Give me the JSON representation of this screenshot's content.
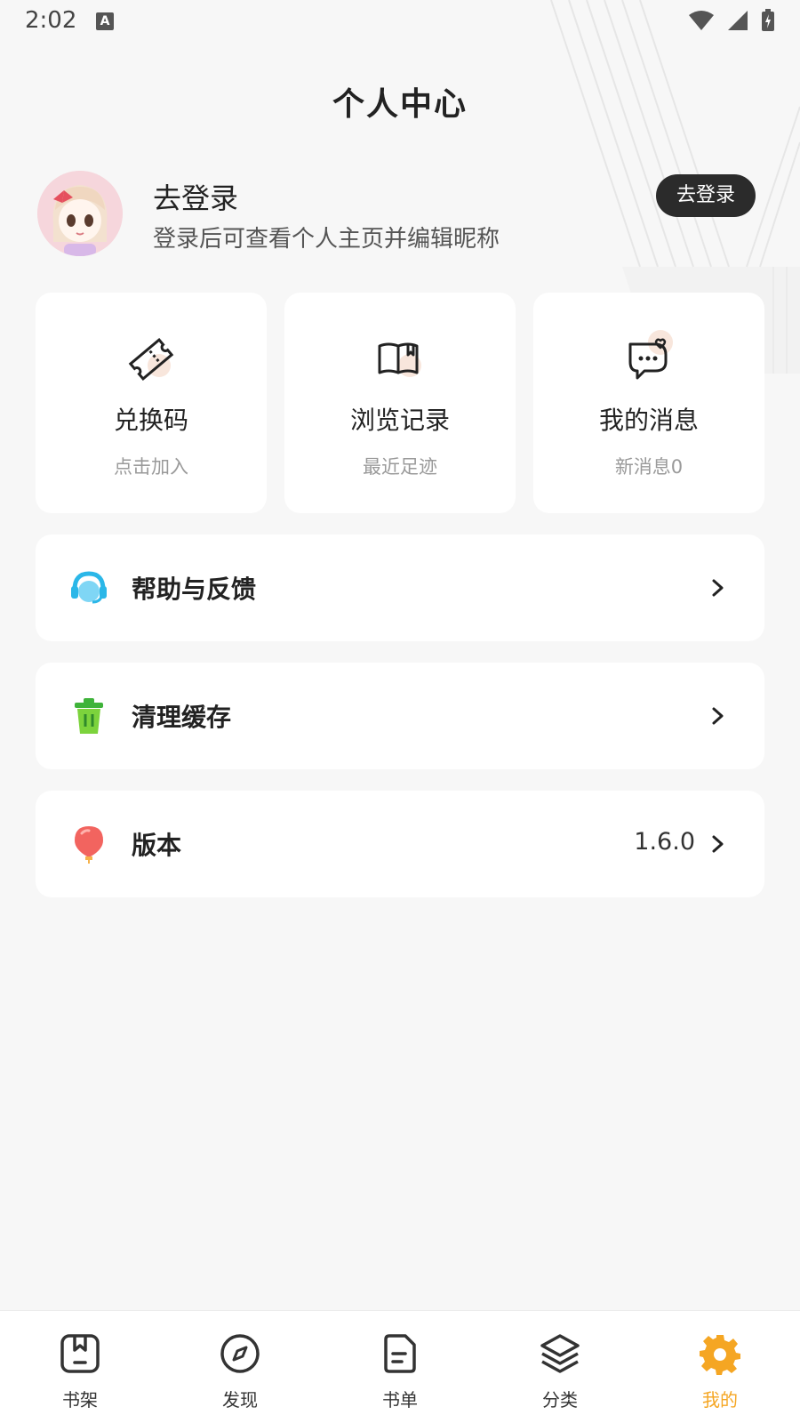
{
  "status_bar": {
    "time": "2:02",
    "notification_icon": "A"
  },
  "page_title": "个人中心",
  "profile": {
    "title": "去登录",
    "subtitle": "登录后可查看个人主页并编辑昵称",
    "login_button": "去登录"
  },
  "cards": [
    {
      "icon": "ticket-icon",
      "title": "兑换码",
      "subtitle": "点击加入"
    },
    {
      "icon": "book-icon",
      "title": "浏览记录",
      "subtitle": "最近足迹"
    },
    {
      "icon": "message-icon",
      "title": "我的消息",
      "subtitle": "新消息0"
    }
  ],
  "menu": [
    {
      "icon": "headset-icon",
      "label": "帮助与反馈",
      "value": ""
    },
    {
      "icon": "trash-icon",
      "label": "清理缓存",
      "value": ""
    },
    {
      "icon": "balloon-icon",
      "label": "版本",
      "value": "1.6.0"
    }
  ],
  "bottom_nav": [
    {
      "icon": "bookshelf-icon",
      "label": "书架",
      "active": false
    },
    {
      "icon": "compass-icon",
      "label": "发现",
      "active": false
    },
    {
      "icon": "booklist-icon",
      "label": "书单",
      "active": false
    },
    {
      "icon": "layers-icon",
      "label": "分类",
      "active": false
    },
    {
      "icon": "gear-icon",
      "label": "我的",
      "active": true
    }
  ],
  "colors": {
    "accent": "#f5a623",
    "dark_button": "#2b2b2b",
    "background": "#f7f7f7"
  }
}
